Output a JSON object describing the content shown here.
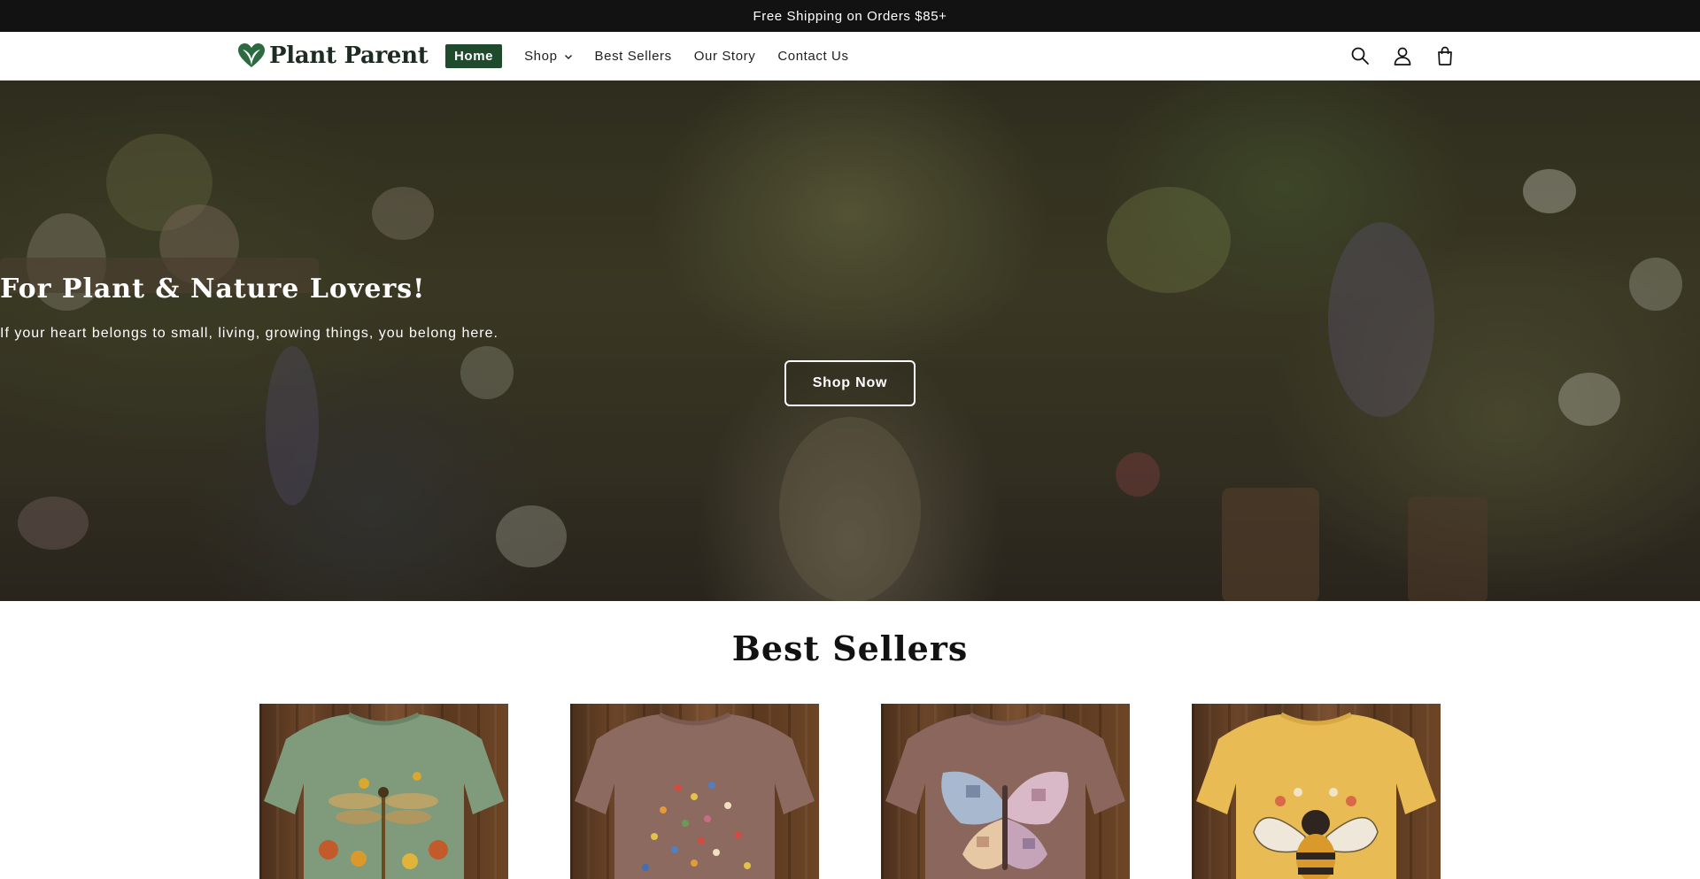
{
  "announcement": {
    "text": "Free Shipping on Orders $85+"
  },
  "header": {
    "logo_text": "Plant Parent",
    "logo_icon": "heart-leaf-icon",
    "nav": [
      {
        "label": "Home",
        "active": true
      },
      {
        "label": "Shop",
        "has_dropdown": true
      },
      {
        "label": "Best Sellers"
      },
      {
        "label": "Our Story"
      },
      {
        "label": "Contact Us"
      }
    ],
    "icons": [
      "search-icon",
      "account-icon",
      "cart-icon"
    ]
  },
  "hero": {
    "title": "For Plant & Nature Lovers!",
    "subtitle": "If your heart belongs to small, living, growing things, you belong here.",
    "cta_label": "Shop Now"
  },
  "best_sellers": {
    "title": "Best Sellers",
    "products": [
      {
        "image": "green t-shirt with dragonfly and wildflowers",
        "shirt_color": "#7f9b7c"
      },
      {
        "image": "brown t-shirt with scattered wildflowers",
        "shirt_color": "#8c6a5f"
      },
      {
        "image": "brown t-shirt with patchwork butterfly",
        "shirt_color": "#8a665c"
      },
      {
        "image": "yellow t-shirt with bee and flowers",
        "shirt_color": "#e9bb55"
      }
    ]
  },
  "colors": {
    "accent": "#1f4a2c",
    "announcement_bg": "#121212"
  }
}
